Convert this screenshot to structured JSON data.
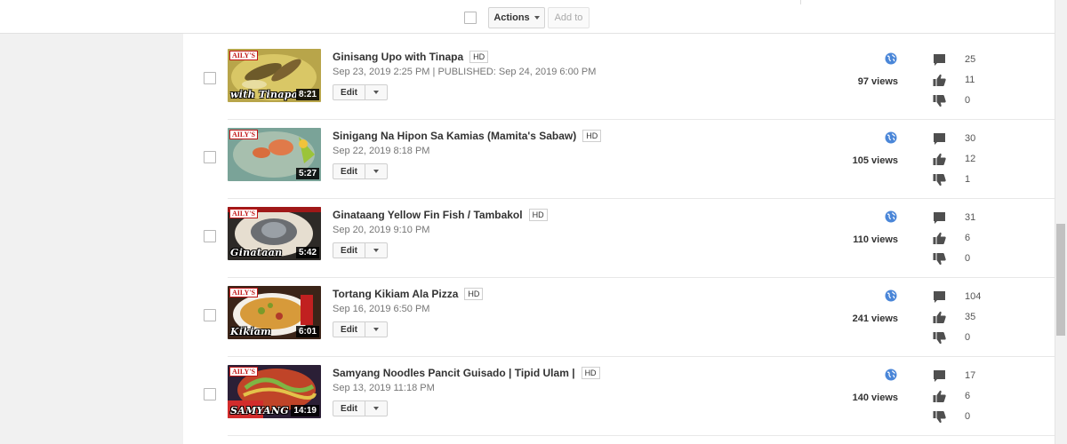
{
  "toolbar": {
    "actions_label": "Actions",
    "add_to_label": "Add to"
  },
  "videos": [
    {
      "title": "Ginisang Upo with Tinapa",
      "hd": "HD",
      "date": "Sep 23, 2019 2:25 PM  |  PUBLISHED: Sep 24, 2019 6:00 PM",
      "edit_label": "Edit",
      "views": "97 views",
      "comments": "25",
      "likes": "11",
      "dislikes": "0",
      "thumb_brand": "AILY'S",
      "thumb_caption": "with Tinapa",
      "duration": "8:21"
    },
    {
      "title": "Sinigang Na Hipon Sa Kamias (Mamita's Sabaw)",
      "hd": "HD",
      "date": "Sep 22, 2019 8:18 PM",
      "edit_label": "Edit",
      "views": "105 views",
      "comments": "30",
      "likes": "12",
      "dislikes": "1",
      "thumb_brand": "AILY'S",
      "thumb_caption": "",
      "duration": "5:27"
    },
    {
      "title": "Ginataang Yellow Fin Fish / Tambakol",
      "hd": "HD",
      "date": "Sep 20, 2019 9:10 PM",
      "edit_label": "Edit",
      "views": "110 views",
      "comments": "31",
      "likes": "6",
      "dislikes": "0",
      "thumb_brand": "AILY'S",
      "thumb_caption": "Ginataan",
      "duration": "5:42"
    },
    {
      "title": "Tortang Kikiam Ala Pizza",
      "hd": "HD",
      "date": "Sep 16, 2019 6:50 PM",
      "edit_label": "Edit",
      "views": "241 views",
      "comments": "104",
      "likes": "35",
      "dislikes": "0",
      "thumb_brand": "AILY'S",
      "thumb_caption": "Kikiam",
      "duration": "6:01"
    },
    {
      "title": "Samyang Noodles Pancit Guisado | Tipid Ulam |",
      "hd": "HD",
      "date": "Sep 13, 2019 11:18 PM",
      "edit_label": "Edit",
      "views": "140 views",
      "comments": "17",
      "likes": "6",
      "dislikes": "0",
      "thumb_brand": "AILY'S",
      "thumb_caption": "SAMYANG",
      "duration": "14:19"
    }
  ],
  "colors": {
    "globe": "#4a86d8",
    "icon": "#4f4f4f",
    "thumb_bg": [
      "#8a7a2a",
      "#6e8a68",
      "#3d3a36",
      "#6a4a26",
      "#2a2430"
    ]
  }
}
